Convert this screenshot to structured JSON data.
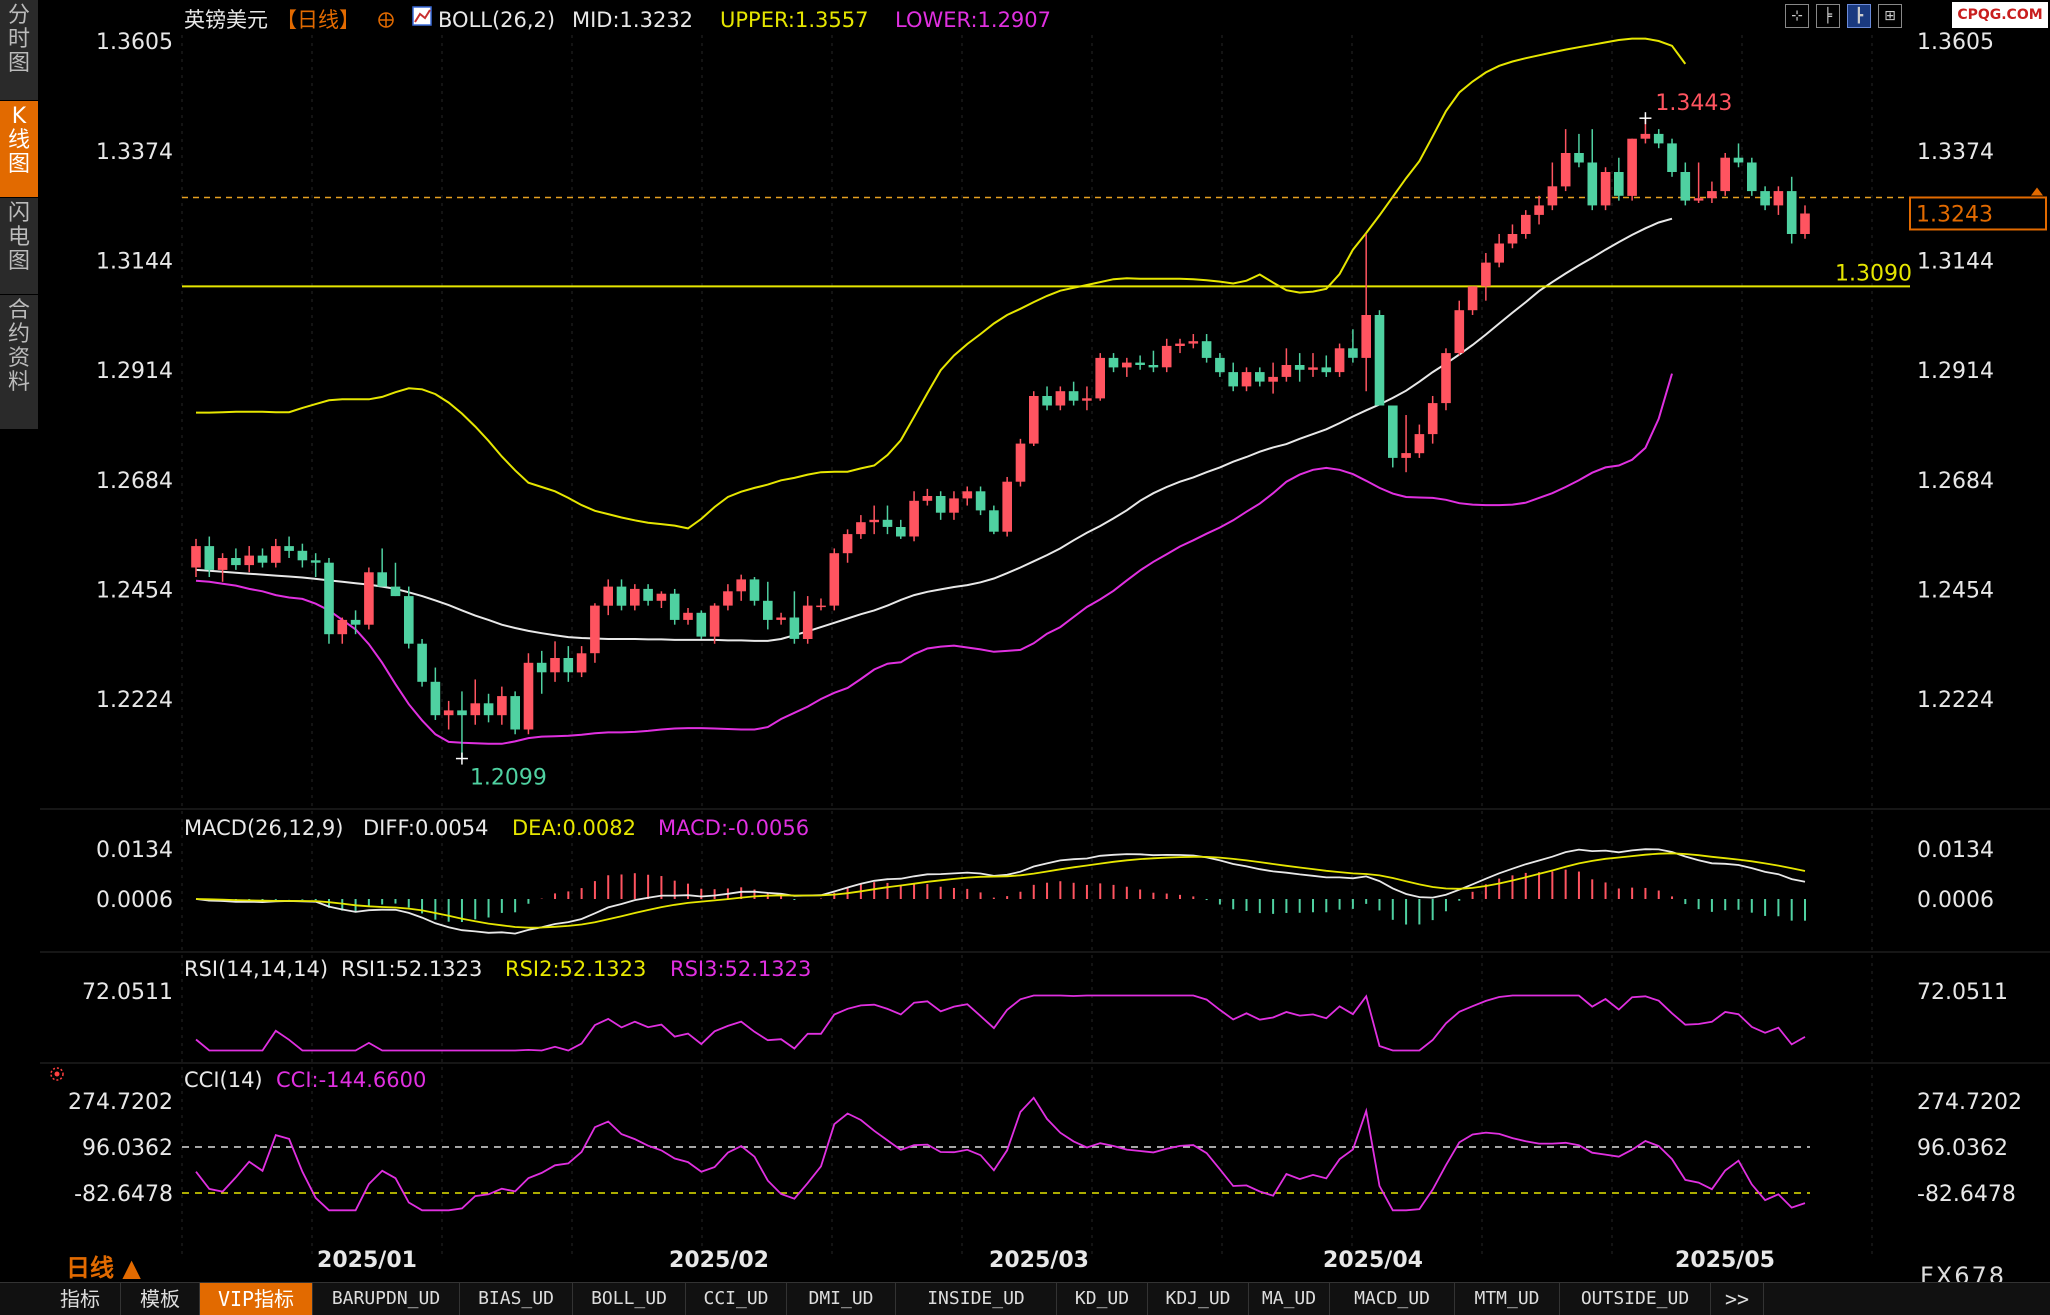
{
  "sidebar": {
    "tabs": [
      {
        "label": "分时图",
        "active": false
      },
      {
        "label": "K线图",
        "active": true
      },
      {
        "label": "闪电图",
        "active": false
      },
      {
        "label": "合约资料",
        "active": false
      }
    ]
  },
  "logo": "CPQG.COM",
  "toolbar_icons": [
    "crosshair-icon",
    "bar-icon",
    "candlestick-icon",
    "gridview-icon"
  ],
  "header": {
    "symbol": "英镑美元",
    "period": "【日线】",
    "boll_label": "BOLL(26,2)",
    "mid": "MID:1.3232",
    "upper": "UPPER:1.3557",
    "lower": "LOWER:1.2907"
  },
  "colors": {
    "up": "#ff5460",
    "down": "#4fd1a1",
    "mid": "#e8e8e8",
    "upper": "#e6e600",
    "lower": "#e030e0",
    "accent": "#e26a00"
  },
  "chart_data": {
    "type": "candlestick",
    "title": "英镑美元【日线】",
    "ylim": [
      1.205,
      1.37
    ],
    "y_ticks": [
      "1.3605",
      "1.3374",
      "1.3144",
      "1.2914",
      "1.2684",
      "1.2454",
      "1.2224"
    ],
    "x_ticks": [
      "2025/01",
      "2025/02",
      "2025/03",
      "2025/04",
      "2025/05"
    ],
    "current_price": "1.3243",
    "support_level": "1.3090",
    "high_label": "1.3443",
    "low_label": "1.2099",
    "upper_band": [
      1.2825,
      1.2825,
      1.2826,
      1.2827,
      1.2827,
      1.2827,
      1.2826,
      1.2826,
      1.2835,
      1.2843,
      1.2851,
      1.2853,
      1.2853,
      1.2853,
      1.2858,
      1.2868,
      1.2876,
      1.2874,
      1.2864,
      1.2846,
      1.2823,
      1.2796,
      1.2766,
      1.2733,
      1.2704,
      1.2678,
      1.2669,
      1.266,
      1.2646,
      1.2631,
      1.2619,
      1.2612,
      1.2605,
      1.2599,
      1.2594,
      1.2591,
      1.2588,
      1.2582,
      1.2602,
      1.2627,
      1.2648,
      1.2659,
      1.2667,
      1.2674,
      1.2683,
      1.2688,
      1.2695,
      1.27,
      1.2701,
      1.2701,
      1.2708,
      1.2714,
      1.2736,
      1.2767,
      1.2816,
      1.2866,
      1.2914,
      1.2945,
      1.2969,
      1.299,
      1.3012,
      1.303,
      1.3043,
      1.3057,
      1.307,
      1.3081,
      1.3087,
      1.3093,
      1.3099,
      1.3105,
      1.3107,
      1.3106,
      1.3106,
      1.3106,
      1.3106,
      1.3105,
      1.3103,
      1.31,
      1.3096,
      1.3102,
      1.3115,
      1.3098,
      1.3082,
      1.3077,
      1.3079,
      1.3085,
      1.3116,
      1.3167,
      1.3202,
      1.3239,
      1.3278,
      1.3317,
      1.3353,
      1.3405,
      1.3458,
      1.3497,
      1.352,
      1.3539,
      1.3553,
      1.3562,
      1.3569,
      1.3575,
      1.3581,
      1.3587,
      1.3592,
      1.3597,
      1.3602,
      1.3607,
      1.361,
      1.361,
      1.3605,
      1.3595,
      1.3557
    ],
    "mid_band": [
      1.2495,
      1.2493,
      1.2491,
      1.2489,
      1.2487,
      1.2485,
      1.2483,
      1.2481,
      1.2479,
      1.2476,
      1.2473,
      1.247,
      1.2467,
      1.2464,
      1.246,
      1.2455,
      1.2448,
      1.244,
      1.2431,
      1.2421,
      1.241,
      1.2399,
      1.239,
      1.238,
      1.2373,
      1.2367,
      1.2362,
      1.2358,
      1.2354,
      1.2352,
      1.2351,
      1.235,
      1.235,
      1.235,
      1.2349,
      1.2349,
      1.2348,
      1.2348,
      1.2348,
      1.2348,
      1.2347,
      1.2347,
      1.2346,
      1.2346,
      1.235,
      1.2358,
      1.2366,
      1.2375,
      1.2384,
      1.2393,
      1.2402,
      1.241,
      1.242,
      1.2432,
      1.2442,
      1.2449,
      1.2454,
      1.2459,
      1.2463,
      1.2469,
      1.2477,
      1.2488,
      1.25,
      1.2513,
      1.2526,
      1.254,
      1.2557,
      1.2573,
      1.2587,
      1.2603,
      1.262,
      1.264,
      1.2656,
      1.2669,
      1.268,
      1.2689,
      1.27,
      1.271,
      1.2722,
      1.2732,
      1.2743,
      1.2752,
      1.2759,
      1.277,
      1.278,
      1.279,
      1.2803,
      1.2817,
      1.283,
      1.2842,
      1.2856,
      1.2871,
      1.289,
      1.291,
      1.2928,
      1.2947,
      1.2967,
      1.2989,
      1.3012,
      1.3035,
      1.3057,
      1.308,
      1.3099,
      1.3117,
      1.3134,
      1.315,
      1.3167,
      1.3183,
      1.3198,
      1.3212,
      1.3224,
      1.3232
    ],
    "lower_band": [
      1.2472,
      1.247,
      1.2466,
      1.2462,
      1.2455,
      1.245,
      1.2442,
      1.2437,
      1.2434,
      1.2424,
      1.241,
      1.239,
      1.237,
      1.2339,
      1.23,
      1.2255,
      1.2213,
      1.2179,
      1.215,
      1.2134,
      1.2132,
      1.2131,
      1.213,
      1.213,
      1.2135,
      1.2142,
      1.2145,
      1.2146,
      1.2147,
      1.2149,
      1.2152,
      1.2154,
      1.2154,
      1.2155,
      1.2157,
      1.216,
      1.2162,
      1.2163,
      1.2163,
      1.2162,
      1.2161,
      1.216,
      1.216,
      1.2165,
      1.2182,
      1.2195,
      1.2208,
      1.2224,
      1.2237,
      1.2247,
      1.2266,
      1.2286,
      1.2298,
      1.2301,
      1.2318,
      1.233,
      1.2334,
      1.2336,
      1.2332,
      1.2328,
      1.2323,
      1.2325,
      1.2327,
      1.2341,
      1.2361,
      1.2375,
      1.2396,
      1.2417,
      1.2433,
      1.2451,
      1.2473,
      1.2494,
      1.2512,
      1.2528,
      1.2544,
      1.2557,
      1.2571,
      1.2584,
      1.2599,
      1.2617,
      1.2634,
      1.2656,
      1.268,
      1.2695,
      1.2705,
      1.2709,
      1.2705,
      1.2696,
      1.2682,
      1.2667,
      1.2655,
      1.2648,
      1.2647,
      1.2646,
      1.2642,
      1.2635,
      1.2632,
      1.2631,
      1.2631,
      1.2632,
      1.2636,
      1.2646,
      1.2656,
      1.2669,
      1.2683,
      1.2699,
      1.271,
      1.2714,
      1.2726,
      1.2751,
      1.2812,
      1.2907
    ],
    "candles": [
      [
        1.25,
        1.256,
        1.248,
        1.2545
      ],
      [
        1.2545,
        1.2565,
        1.248,
        1.2495
      ],
      [
        1.2495,
        1.253,
        1.247,
        1.252
      ],
      [
        1.252,
        1.254,
        1.2495,
        1.2505
      ],
      [
        1.2505,
        1.2545,
        1.249,
        1.2525
      ],
      [
        1.2525,
        1.254,
        1.25,
        1.251
      ],
      [
        1.251,
        1.256,
        1.25,
        1.2545
      ],
      [
        1.2545,
        1.2565,
        1.252,
        1.2535
      ],
      [
        1.2535,
        1.255,
        1.25,
        1.2515
      ],
      [
        1.2515,
        1.253,
        1.248,
        1.251
      ],
      [
        1.251,
        1.252,
        1.234,
        1.236
      ],
      [
        1.236,
        1.2395,
        1.234,
        1.239
      ],
      [
        1.239,
        1.241,
        1.236,
        1.238
      ],
      [
        1.238,
        1.25,
        1.237,
        1.249
      ],
      [
        1.249,
        1.254,
        1.246,
        1.246
      ],
      [
        1.246,
        1.251,
        1.244,
        1.244
      ],
      [
        1.244,
        1.246,
        1.233,
        1.234
      ],
      [
        1.234,
        1.235,
        1.225,
        1.226
      ],
      [
        1.226,
        1.229,
        1.218,
        1.219
      ],
      [
        1.219,
        1.222,
        1.216,
        1.22
      ],
      [
        1.22,
        1.224,
        1.2099,
        1.219
      ],
      [
        1.219,
        1.2265,
        1.217,
        1.2215
      ],
      [
        1.2215,
        1.2235,
        1.2175,
        1.219
      ],
      [
        1.219,
        1.225,
        1.217,
        1.223
      ],
      [
        1.223,
        1.224,
        1.215,
        1.216
      ],
      [
        1.216,
        1.232,
        1.215,
        1.23
      ],
      [
        1.23,
        1.2325,
        1.2235,
        1.228
      ],
      [
        1.228,
        1.2345,
        1.226,
        1.231
      ],
      [
        1.231,
        1.2335,
        1.226,
        1.228
      ],
      [
        1.228,
        1.2335,
        1.227,
        1.232
      ],
      [
        1.232,
        1.2425,
        1.23,
        1.242
      ],
      [
        1.242,
        1.2475,
        1.24,
        1.246
      ],
      [
        1.246,
        1.2475,
        1.241,
        1.242
      ],
      [
        1.242,
        1.2465,
        1.241,
        1.2455
      ],
      [
        1.2455,
        1.2465,
        1.242,
        1.243
      ],
      [
        1.243,
        1.245,
        1.2415,
        1.2445
      ],
      [
        1.2445,
        1.2455,
        1.238,
        1.239
      ],
      [
        1.239,
        1.2415,
        1.238,
        1.2405
      ],
      [
        1.2405,
        1.241,
        1.235,
        1.2355
      ],
      [
        1.2355,
        1.2425,
        1.234,
        1.242
      ],
      [
        1.242,
        1.2465,
        1.241,
        1.245
      ],
      [
        1.245,
        1.2485,
        1.243,
        1.2475
      ],
      [
        1.2475,
        1.248,
        1.242,
        1.243
      ],
      [
        1.243,
        1.247,
        1.237,
        1.239
      ],
      [
        1.239,
        1.2405,
        1.238,
        1.2395
      ],
      [
        1.2395,
        1.245,
        1.234,
        1.235
      ],
      [
        1.235,
        1.244,
        1.234,
        1.242
      ],
      [
        1.242,
        1.2435,
        1.241,
        1.242
      ],
      [
        1.242,
        1.254,
        1.241,
        1.253
      ],
      [
        1.253,
        1.258,
        1.251,
        1.257
      ],
      [
        1.257,
        1.261,
        1.256,
        1.2595
      ],
      [
        1.2595,
        1.263,
        1.257,
        1.26
      ],
      [
        1.26,
        1.263,
        1.257,
        1.2585
      ],
      [
        1.2585,
        1.26,
        1.256,
        1.2565
      ],
      [
        1.2565,
        1.266,
        1.2555,
        1.264
      ],
      [
        1.264,
        1.2665,
        1.263,
        1.265
      ],
      [
        1.265,
        1.266,
        1.26,
        1.2615
      ],
      [
        1.2615,
        1.266,
        1.26,
        1.2645
      ],
      [
        1.2645,
        1.267,
        1.263,
        1.266
      ],
      [
        1.266,
        1.267,
        1.261,
        1.262
      ],
      [
        1.262,
        1.263,
        1.257,
        1.2575
      ],
      [
        1.2575,
        1.269,
        1.2565,
        1.268
      ],
      [
        1.268,
        1.277,
        1.267,
        1.276
      ],
      [
        1.276,
        1.287,
        1.2755,
        1.286
      ],
      [
        1.286,
        1.288,
        1.283,
        1.284
      ],
      [
        1.284,
        1.288,
        1.283,
        1.287
      ],
      [
        1.287,
        1.289,
        1.284,
        1.285
      ],
      [
        1.285,
        1.288,
        1.283,
        1.2855
      ],
      [
        1.2855,
        1.295,
        1.285,
        1.294
      ],
      [
        1.294,
        1.295,
        1.291,
        1.292
      ],
      [
        1.292,
        1.294,
        1.29,
        1.293
      ],
      [
        1.293,
        1.2945,
        1.2915,
        1.2925
      ],
      [
        1.2925,
        1.2955,
        1.291,
        1.292
      ],
      [
        1.292,
        1.298,
        1.291,
        1.2965
      ],
      [
        1.2965,
        1.298,
        1.295,
        1.297
      ],
      [
        1.297,
        1.299,
        1.296,
        1.2975
      ],
      [
        1.2975,
        1.299,
        1.293,
        1.294
      ],
      [
        1.294,
        1.295,
        1.29,
        1.291
      ],
      [
        1.291,
        1.293,
        1.287,
        1.288
      ],
      [
        1.288,
        1.292,
        1.287,
        1.291
      ],
      [
        1.291,
        1.292,
        1.288,
        1.289
      ],
      [
        1.289,
        1.293,
        1.2865,
        1.29
      ],
      [
        1.29,
        1.296,
        1.289,
        1.2925
      ],
      [
        1.2925,
        1.295,
        1.289,
        1.2915
      ],
      [
        1.2915,
        1.295,
        1.29,
        1.292
      ],
      [
        1.292,
        1.2945,
        1.29,
        1.291
      ],
      [
        1.291,
        1.297,
        1.29,
        1.296
      ],
      [
        1.296,
        1.3,
        1.293,
        1.294
      ],
      [
        1.294,
        1.32,
        1.287,
        1.303
      ],
      [
        1.303,
        1.304,
        1.284,
        1.284
      ],
      [
        1.284,
        1.284,
        1.271,
        1.273
      ],
      [
        1.273,
        1.282,
        1.27,
        1.274
      ],
      [
        1.274,
        1.28,
        1.273,
        1.278
      ],
      [
        1.278,
        1.286,
        1.276,
        1.2845
      ],
      [
        1.2845,
        1.296,
        1.283,
        1.295
      ],
      [
        1.295,
        1.306,
        1.2945,
        1.304
      ],
      [
        1.304,
        1.309,
        1.303,
        1.309
      ],
      [
        1.309,
        1.316,
        1.306,
        1.314
      ],
      [
        1.314,
        1.32,
        1.313,
        1.318
      ],
      [
        1.318,
        1.322,
        1.317,
        1.32
      ],
      [
        1.32,
        1.325,
        1.319,
        1.324
      ],
      [
        1.324,
        1.328,
        1.322,
        1.326
      ],
      [
        1.326,
        1.335,
        1.325,
        1.33
      ],
      [
        1.33,
        1.342,
        1.329,
        1.337
      ],
      [
        1.337,
        1.341,
        1.334,
        1.335
      ],
      [
        1.335,
        1.342,
        1.325,
        1.326
      ],
      [
        1.326,
        1.334,
        1.325,
        1.333
      ],
      [
        1.333,
        1.336,
        1.327,
        1.328
      ],
      [
        1.328,
        1.34,
        1.327,
        1.34
      ],
      [
        1.34,
        1.3443,
        1.339,
        1.341
      ],
      [
        1.341,
        1.342,
        1.338,
        1.339
      ],
      [
        1.339,
        1.34,
        1.332,
        1.333
      ],
      [
        1.333,
        1.335,
        1.326,
        1.327
      ],
      [
        1.327,
        1.335,
        1.3265,
        1.3275
      ],
      [
        1.3275,
        1.331,
        1.3265,
        1.329
      ],
      [
        1.329,
        1.337,
        1.328,
        1.336
      ],
      [
        1.336,
        1.339,
        1.334,
        1.335
      ],
      [
        1.335,
        1.336,
        1.328,
        1.329
      ],
      [
        1.329,
        1.33,
        1.325,
        1.326
      ],
      [
        1.326,
        1.33,
        1.324,
        1.329
      ],
      [
        1.329,
        1.332,
        1.318,
        1.32
      ],
      [
        1.32,
        1.326,
        1.319,
        1.3243
      ]
    ]
  },
  "macd": {
    "label": "MACD(26,12,9)",
    "diff": "DIFF:0.0054",
    "dea": "DEA:0.0082",
    "macd": "MACD:-0.0056",
    "ticks": [
      "0.0134",
      "0.0006"
    ]
  },
  "rsi": {
    "label": "RSI(14,14,14)",
    "rsi1": "RSI1:52.1323",
    "rsi2": "RSI2:52.1323",
    "rsi3": "RSI3:52.1323",
    "ticks": [
      "72.0511"
    ]
  },
  "cci": {
    "label": "CCI(14)",
    "value": "CCI:-144.6600",
    "ticks": [
      "274.7202",
      "96.0362",
      "-82.6478"
    ]
  },
  "period_button": "日线 ▲",
  "footer_code": "FX678",
  "bottom_tabs": [
    {
      "label": "指标",
      "active": false
    },
    {
      "label": "模板",
      "active": false
    },
    {
      "label": "VIP指标",
      "active": true
    },
    {
      "label": "BARUPDN_UD",
      "active": false
    },
    {
      "label": "BIAS_UD",
      "active": false
    },
    {
      "label": "BOLL_UD",
      "active": false
    },
    {
      "label": "CCI_UD",
      "active": false
    },
    {
      "label": "DMI_UD",
      "active": false
    },
    {
      "label": "INSIDE_UD",
      "active": false
    },
    {
      "label": "KD_UD",
      "active": false
    },
    {
      "label": "KDJ_UD",
      "active": false
    },
    {
      "label": "MA_UD",
      "active": false
    },
    {
      "label": "MACD_UD",
      "active": false
    },
    {
      "label": "MTM_UD",
      "active": false
    },
    {
      "label": "OUTSIDE_UD",
      "active": false
    },
    {
      "label": ">>",
      "active": false
    }
  ]
}
